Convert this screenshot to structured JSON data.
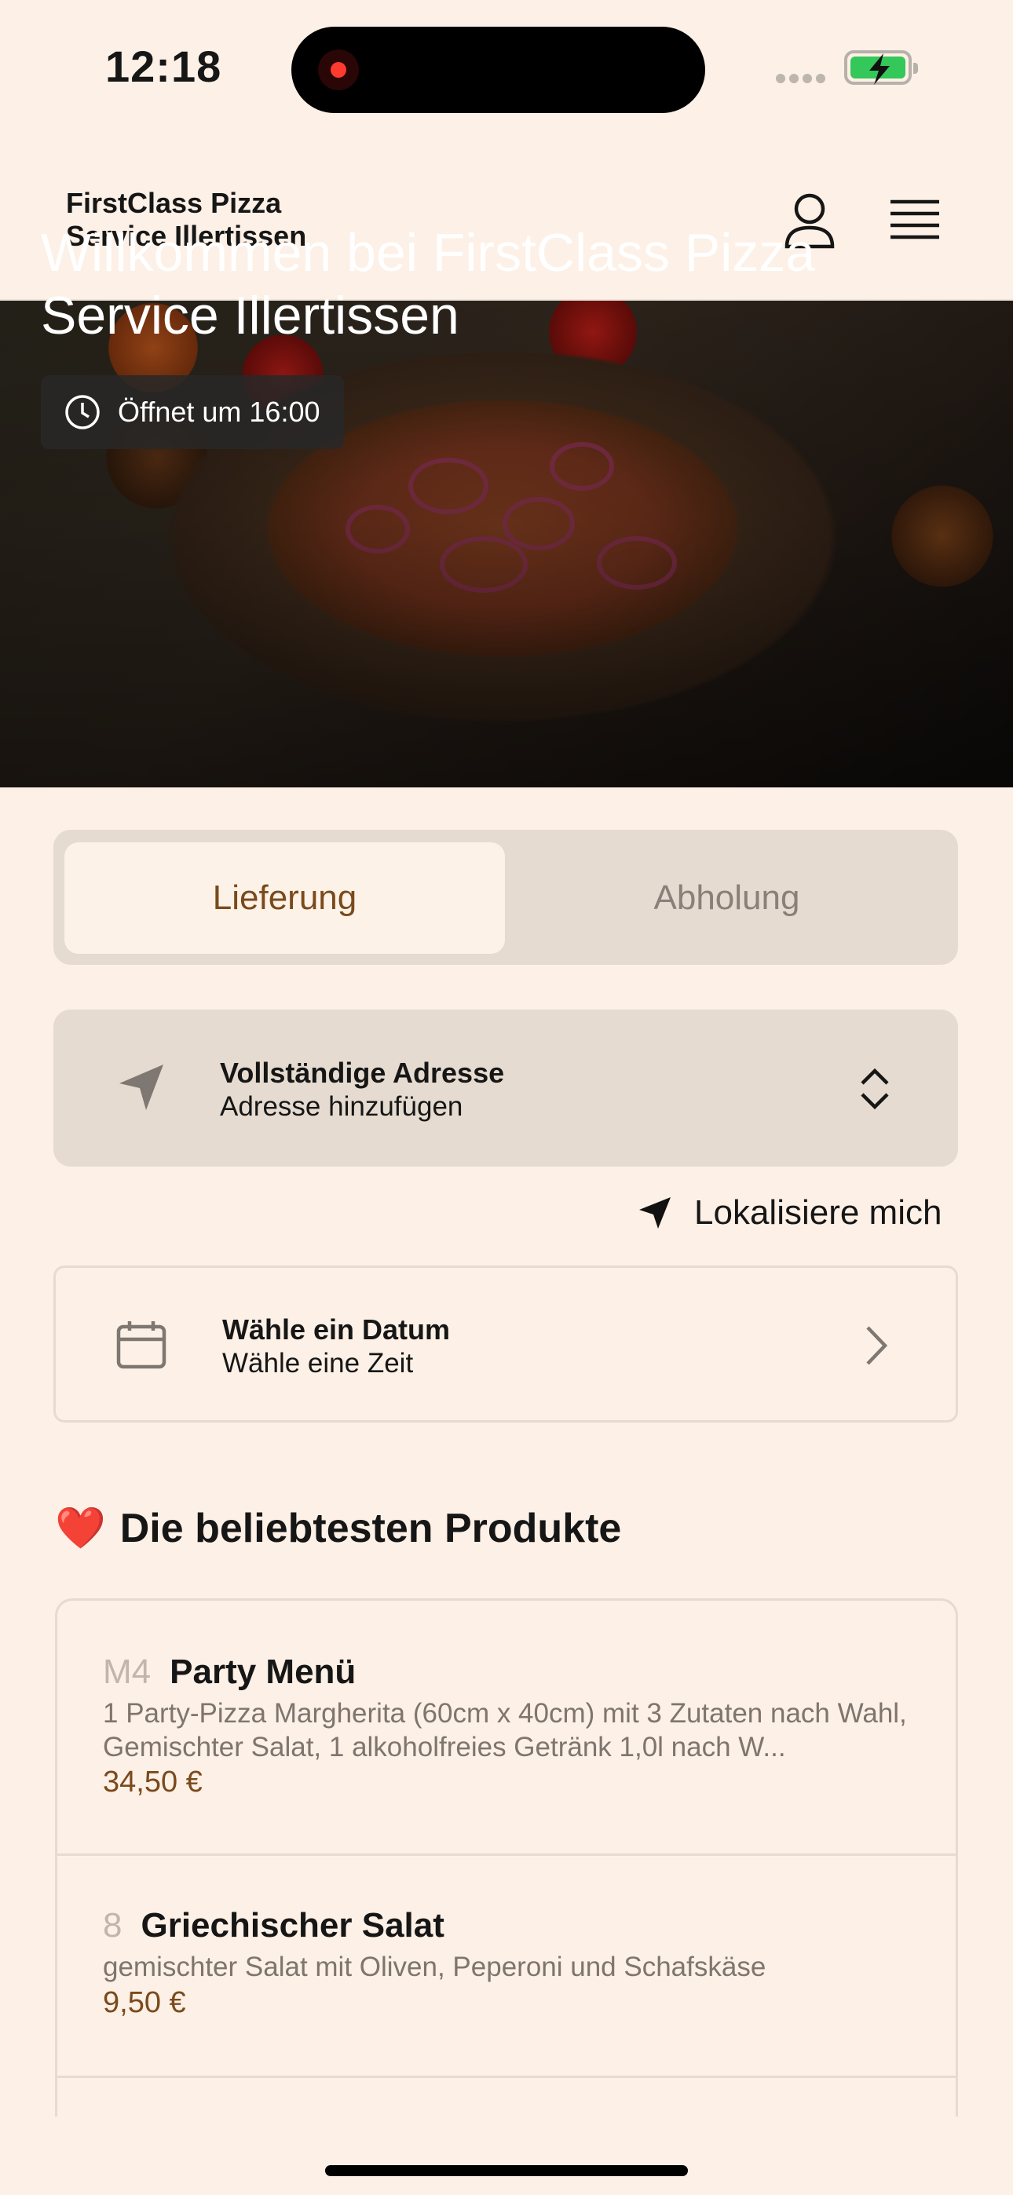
{
  "status_bar": {
    "time": "12:18"
  },
  "header": {
    "brand_name": "FirstClass Pizza Service Illertissen"
  },
  "hero": {
    "title": "Willkommen bei FirstClass Pizza Service Illertissen",
    "opening_hours": "Öffnet um 16:00"
  },
  "order_mode": {
    "options": [
      "Lieferung",
      "Abholung"
    ],
    "selected": "Lieferung"
  },
  "address": {
    "title": "Vollständige Adresse",
    "subtitle": "Adresse hinzufügen",
    "locate_label": "Lokalisiere mich"
  },
  "schedule": {
    "title": "Wähle ein Datum",
    "subtitle": "Wähle eine Zeit"
  },
  "popular": {
    "heading": "Die beliebtesten Produkte",
    "emoji": "❤️",
    "products": [
      {
        "number": "M4",
        "name": "Party Menü",
        "description": "1 Party-Pizza Margherita (60cm x 40cm) mit 3 Zutaten nach Wahl, Gemischter Salat, 1 alkoholfreies Getränk 1,0l nach W...",
        "price": "34,50 €"
      },
      {
        "number": "8",
        "name": "Griechischer Salat",
        "description": "gemischter Salat mit Oliven, Peperoni und Schafskäse",
        "price": "9,50 €"
      }
    ]
  },
  "colors": {
    "background": "#fdf0e6",
    "accent": "#7a4a1c",
    "panel": "#e6dbd0"
  }
}
